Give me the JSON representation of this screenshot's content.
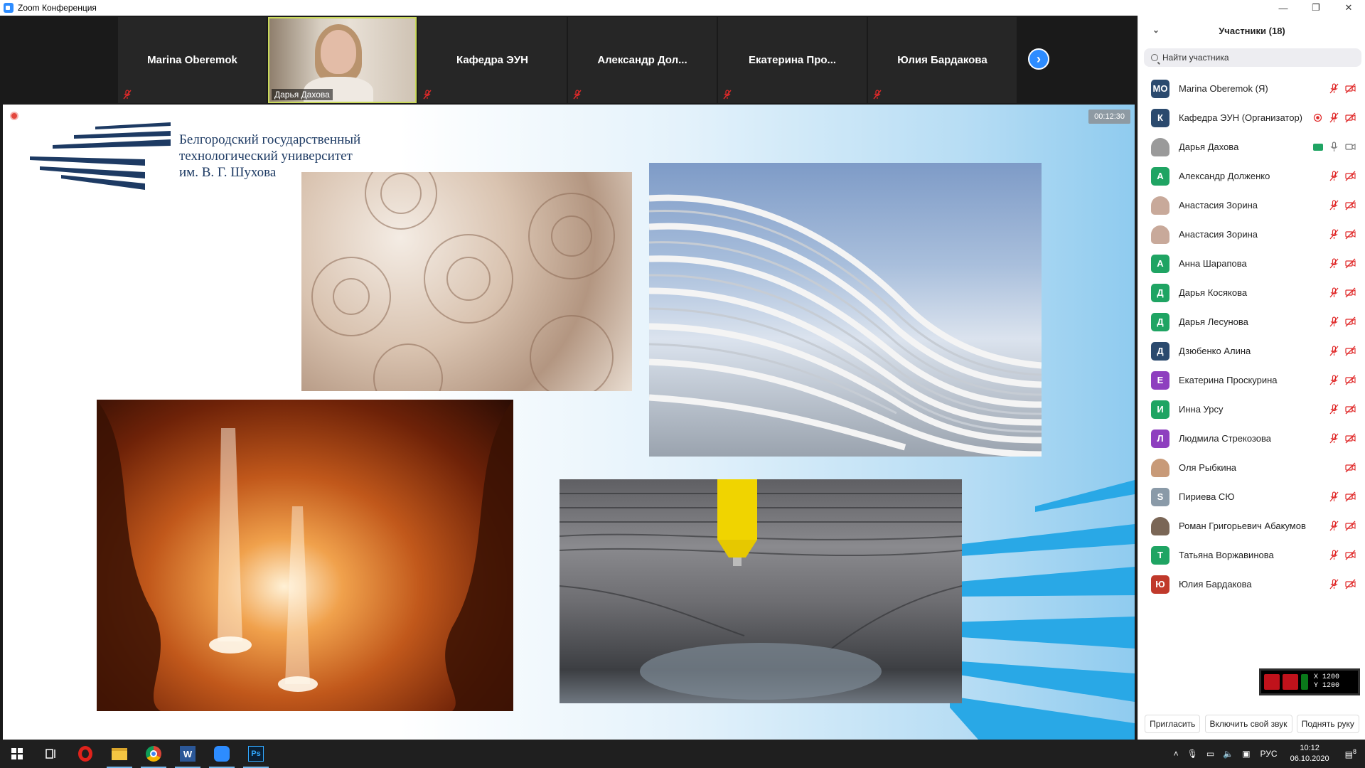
{
  "window": {
    "title": "Zoom Конференция",
    "controls": [
      "—",
      "❐",
      "✕"
    ]
  },
  "strip": {
    "tiles": [
      {
        "name": "Marina Oberemok",
        "muted": true,
        "video": false
      },
      {
        "name": "Дарья Дахова",
        "muted": true,
        "video": true
      },
      {
        "name": "Кафедра ЭУН",
        "muted": true,
        "video": false
      },
      {
        "name": "Александр  Дол...",
        "muted": true,
        "video": false
      },
      {
        "name": "Екатерина  Про...",
        "muted": true,
        "video": false
      },
      {
        "name": "Юлия Бардакова",
        "muted": true,
        "video": false
      }
    ],
    "next_glyph": "›"
  },
  "slide": {
    "timer": "00:12:30",
    "university": [
      "Белгородский государственный",
      "технологический университет",
      "им. В. Г. Шухова"
    ],
    "photos": [
      "coral",
      "architecture",
      "canyon",
      "3d-print"
    ]
  },
  "participants": {
    "title": "Участники (18)",
    "search_placeholder": "Найти участника",
    "list": [
      {
        "name": "Marina Oberemok (Я)",
        "initials": "МО",
        "color": "#2b4a6e",
        "mic": "muted",
        "cam": "off"
      },
      {
        "name": "Кафедра ЭУН (Организатор)",
        "initials": "К",
        "color": "#2b4a6e",
        "mic": "muted",
        "cam": "off",
        "recording": true
      },
      {
        "name": "Дарья Дахова",
        "initials": "",
        "color": "#9a9a9a",
        "mic": "on",
        "cam": "on",
        "share": true,
        "photo": true
      },
      {
        "name": "Александр Долженко",
        "initials": "А",
        "color": "#1fa463",
        "mic": "muted",
        "cam": "off"
      },
      {
        "name": "Анастасия Зорина",
        "initials": "",
        "color": "#c8a99a",
        "mic": "muted",
        "cam": "off",
        "photo": true
      },
      {
        "name": "Анастасия Зорина",
        "initials": "",
        "color": "#c8a99a",
        "mic": "muted",
        "cam": "off",
        "photo": true
      },
      {
        "name": "Анна Шарапова",
        "initials": "А",
        "color": "#1fa463",
        "mic": "muted",
        "cam": "off"
      },
      {
        "name": "Дарья Косякова",
        "initials": "Д",
        "color": "#1fa463",
        "mic": "muted",
        "cam": "off"
      },
      {
        "name": "Дарья Лесунова",
        "initials": "Д",
        "color": "#1fa463",
        "mic": "muted",
        "cam": "off"
      },
      {
        "name": "Дзюбенко Алина",
        "initials": "Д",
        "color": "#2b4a6e",
        "mic": "muted",
        "cam": "off"
      },
      {
        "name": "Екатерина Проскурина",
        "initials": "Е",
        "color": "#8e3fbf",
        "mic": "muted",
        "cam": "off"
      },
      {
        "name": "Инна Урсу",
        "initials": "И",
        "color": "#1fa463",
        "mic": "muted",
        "cam": "off"
      },
      {
        "name": "Людмила Стрекозова",
        "initials": "Л",
        "color": "#8e3fbf",
        "mic": "muted",
        "cam": "off"
      },
      {
        "name": "Оля Рыбкина",
        "initials": "",
        "color": "#c89a78",
        "mic": "none",
        "cam": "off",
        "photo": true
      },
      {
        "name": "Пириева СЮ",
        "initials": "S",
        "color": "#8a9aa8",
        "mic": "muted",
        "cam": "off"
      },
      {
        "name": "Роман Григорьевич Абакумов",
        "initials": "",
        "color": "#7a6656",
        "mic": "muted",
        "cam": "off",
        "photo": true
      },
      {
        "name": "Татьяна Воржавинова",
        "initials": "Т",
        "color": "#1fa463",
        "mic": "muted",
        "cam": "off"
      },
      {
        "name": "Юлия Бардакова",
        "initials": "Ю",
        "color": "#c0392b",
        "mic": "muted",
        "cam": "off"
      }
    ],
    "footer": {
      "invite": "Пригласить",
      "unmute": "Включить свой звук",
      "raise_hand": "Поднять руку"
    }
  },
  "widget": {
    "x_line": "X 1200",
    "y_line": "Y 1200"
  },
  "taskbar": {
    "apps": [
      "windows-start",
      "task-view",
      "opera",
      "file-explorer",
      "chrome",
      "word",
      "zoom",
      "photoshop"
    ],
    "language": "РУС",
    "time": "10:12",
    "date": "06.10.2020",
    "notifications": "8"
  }
}
